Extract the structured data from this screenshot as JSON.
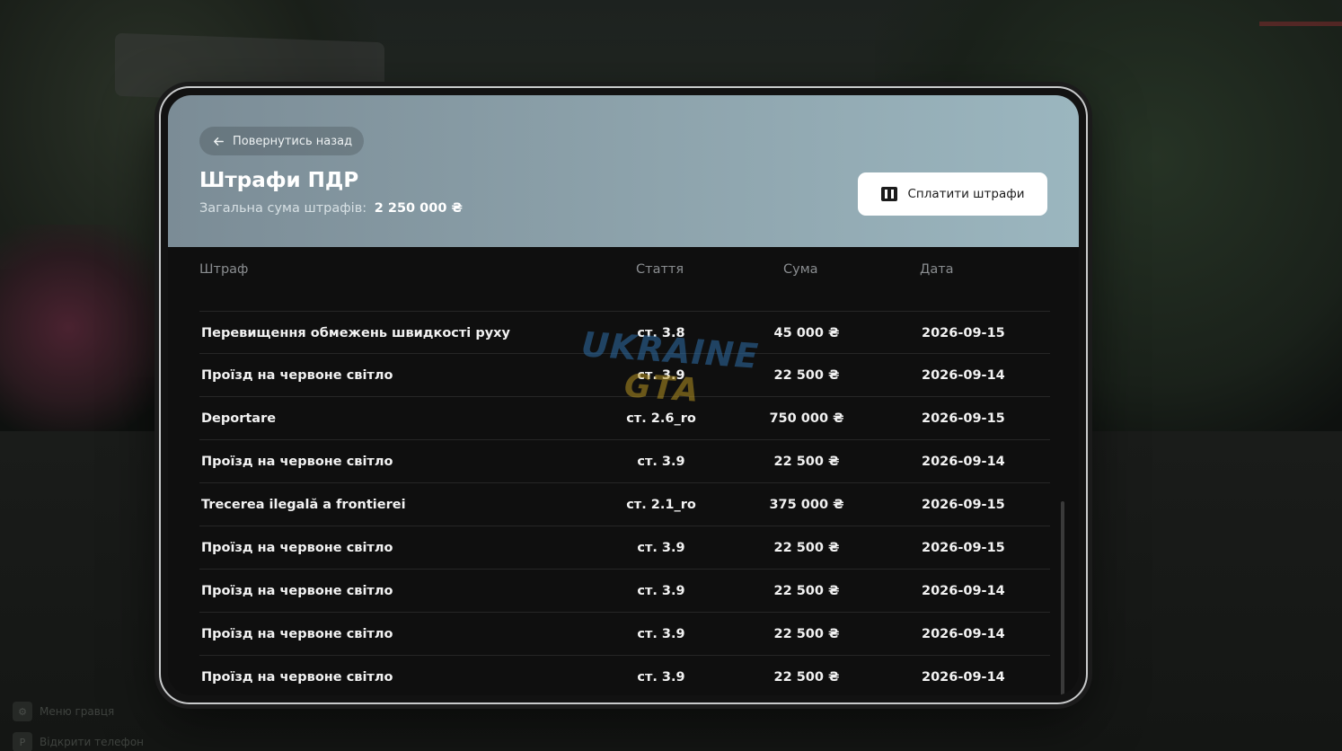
{
  "header": {
    "back_label": "Повернутись назад",
    "title": "Штрафи ПДР",
    "total_label": "Загальна сума штрафів:",
    "total_amount": "2 250 000 ₴",
    "pay_label": "Сплатити штрафи"
  },
  "table": {
    "columns": [
      "Штраф",
      "Стаття",
      "Сума",
      "Дата"
    ],
    "rows": [
      {
        "name": "Перевищення обмежень швидкості руху",
        "article": "ст. 3.8",
        "amount": "45 000 ₴",
        "date": "2026-09-15"
      },
      {
        "name": "Проїзд на червоне світло",
        "article": "ст. 3.9",
        "amount": "22 500 ₴",
        "date": "2026-09-14"
      },
      {
        "name": "Deportare",
        "article": "ст. 2.6_ro",
        "amount": "750 000 ₴",
        "date": "2026-09-15"
      },
      {
        "name": "Проїзд на червоне світло",
        "article": "ст. 3.9",
        "amount": "22 500 ₴",
        "date": "2026-09-14"
      },
      {
        "name": "Trecerea ilegală a frontierei",
        "article": "ст. 2.1_ro",
        "amount": "375 000 ₴",
        "date": "2026-09-15"
      },
      {
        "name": "Проїзд на червоне світло",
        "article": "ст. 3.9",
        "amount": "22 500 ₴",
        "date": "2026-09-15"
      },
      {
        "name": "Проїзд на червоне світло",
        "article": "ст. 3.9",
        "amount": "22 500 ₴",
        "date": "2026-09-14"
      },
      {
        "name": "Проїзд на червоне світло",
        "article": "ст. 3.9",
        "amount": "22 500 ₴",
        "date": "2026-09-14"
      },
      {
        "name": "Проїзд на червоне світло",
        "article": "ст. 3.9",
        "amount": "22 500 ₴",
        "date": "2026-09-14"
      }
    ]
  },
  "watermark": {
    "line1": "UKRAINE",
    "line2": "GTA"
  },
  "hud": {
    "items": [
      {
        "key": "⚙",
        "label": "Меню гравця"
      },
      {
        "key": "P",
        "label": "Відкрити телефон"
      }
    ]
  },
  "icons": {
    "back": "arrow-left-icon",
    "pay": "wallet-icon"
  },
  "colors": {
    "header_start": "#7b8c96",
    "header_end": "#9bb6bf",
    "table_bg": "#0f0f0f",
    "pay_button_bg": "#ffffff"
  }
}
